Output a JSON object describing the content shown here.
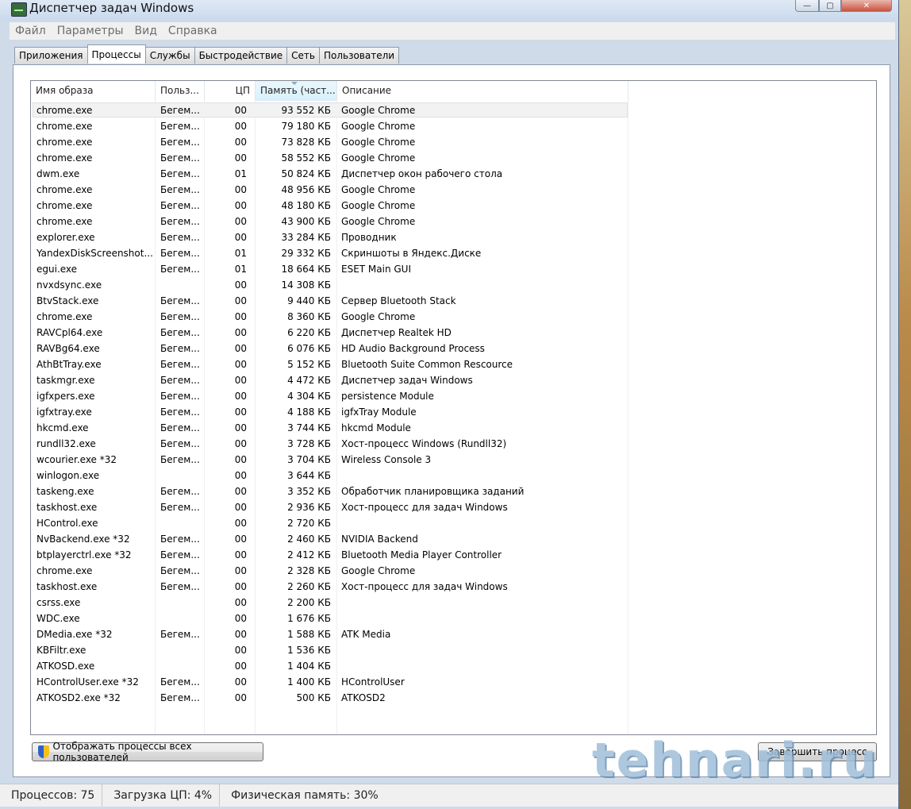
{
  "window": {
    "title": "Диспетчер задач Windows"
  },
  "menu": [
    "Файл",
    "Параметры",
    "Вид",
    "Справка"
  ],
  "tabs": [
    {
      "label": "Приложения",
      "active": false
    },
    {
      "label": "Процессы",
      "active": true
    },
    {
      "label": "Службы",
      "active": false
    },
    {
      "label": "Быстродействие",
      "active": false
    },
    {
      "label": "Сеть",
      "active": false
    },
    {
      "label": "Пользователи",
      "active": false
    }
  ],
  "columns": {
    "name": "Имя образа",
    "user": "Польз...",
    "cpu": "ЦП",
    "memory": "Память (част...",
    "description": "Описание"
  },
  "processes": [
    {
      "name": "chrome.exe",
      "user": "Бегем...",
      "cpu": "00",
      "mem": "93 552 КБ",
      "desc": "Google Chrome"
    },
    {
      "name": "chrome.exe",
      "user": "Бегем...",
      "cpu": "00",
      "mem": "79 180 КБ",
      "desc": "Google Chrome"
    },
    {
      "name": "chrome.exe",
      "user": "Бегем...",
      "cpu": "00",
      "mem": "73 828 КБ",
      "desc": "Google Chrome"
    },
    {
      "name": "chrome.exe",
      "user": "Бегем...",
      "cpu": "00",
      "mem": "58 552 КБ",
      "desc": "Google Chrome"
    },
    {
      "name": "dwm.exe",
      "user": "Бегем...",
      "cpu": "01",
      "mem": "50 824 КБ",
      "desc": "Диспетчер окон рабочего стола"
    },
    {
      "name": "chrome.exe",
      "user": "Бегем...",
      "cpu": "00",
      "mem": "48 956 КБ",
      "desc": "Google Chrome"
    },
    {
      "name": "chrome.exe",
      "user": "Бегем...",
      "cpu": "00",
      "mem": "48 180 КБ",
      "desc": "Google Chrome"
    },
    {
      "name": "chrome.exe",
      "user": "Бегем...",
      "cpu": "00",
      "mem": "43 900 КБ",
      "desc": "Google Chrome"
    },
    {
      "name": "explorer.exe",
      "user": "Бегем...",
      "cpu": "00",
      "mem": "33 284 КБ",
      "desc": "Проводник"
    },
    {
      "name": "YandexDiskScreenshot...",
      "user": "Бегем...",
      "cpu": "01",
      "mem": "29 332 КБ",
      "desc": "Скриншоты в Яндекс.Диске"
    },
    {
      "name": "egui.exe",
      "user": "Бегем...",
      "cpu": "01",
      "mem": "18 664 КБ",
      "desc": "ESET Main GUI"
    },
    {
      "name": "nvxdsync.exe",
      "user": "",
      "cpu": "00",
      "mem": "14 308 КБ",
      "desc": ""
    },
    {
      "name": "BtvStack.exe",
      "user": "Бегем...",
      "cpu": "00",
      "mem": "9 440 КБ",
      "desc": "Сервер Bluetooth Stack"
    },
    {
      "name": "chrome.exe",
      "user": "Бегем...",
      "cpu": "00",
      "mem": "8 360 КБ",
      "desc": "Google Chrome"
    },
    {
      "name": "RAVCpl64.exe",
      "user": "Бегем...",
      "cpu": "00",
      "mem": "6 220 КБ",
      "desc": "Диспетчер Realtek HD"
    },
    {
      "name": "RAVBg64.exe",
      "user": "Бегем...",
      "cpu": "00",
      "mem": "6 076 КБ",
      "desc": "HD Audio Background Process"
    },
    {
      "name": "AthBtTray.exe",
      "user": "Бегем...",
      "cpu": "00",
      "mem": "5 152 КБ",
      "desc": "Bluetooth Suite Common Rescource"
    },
    {
      "name": "taskmgr.exe",
      "user": "Бегем...",
      "cpu": "00",
      "mem": "4 472 КБ",
      "desc": "Диспетчер задач Windows"
    },
    {
      "name": "igfxpers.exe",
      "user": "Бегем...",
      "cpu": "00",
      "mem": "4 304 КБ",
      "desc": "persistence Module"
    },
    {
      "name": "igfxtray.exe",
      "user": "Бегем...",
      "cpu": "00",
      "mem": "4 188 КБ",
      "desc": "igfxTray Module"
    },
    {
      "name": "hkcmd.exe",
      "user": "Бегем...",
      "cpu": "00",
      "mem": "3 744 КБ",
      "desc": "hkcmd Module"
    },
    {
      "name": "rundll32.exe",
      "user": "Бегем...",
      "cpu": "00",
      "mem": "3 728 КБ",
      "desc": "Хост-процесс Windows (Rundll32)"
    },
    {
      "name": "wcourier.exe *32",
      "user": "Бегем...",
      "cpu": "00",
      "mem": "3 704 КБ",
      "desc": "Wireless Console 3"
    },
    {
      "name": "winlogon.exe",
      "user": "",
      "cpu": "00",
      "mem": "3 644 КБ",
      "desc": ""
    },
    {
      "name": "taskeng.exe",
      "user": "Бегем...",
      "cpu": "00",
      "mem": "3 352 КБ",
      "desc": "Обработчик планировщика заданий"
    },
    {
      "name": "taskhost.exe",
      "user": "Бегем...",
      "cpu": "00",
      "mem": "2 936 КБ",
      "desc": "Хост-процесс для задач Windows"
    },
    {
      "name": "HControl.exe",
      "user": "",
      "cpu": "00",
      "mem": "2 720 КБ",
      "desc": ""
    },
    {
      "name": "NvBackend.exe *32",
      "user": "Бегем...",
      "cpu": "00",
      "mem": "2 460 КБ",
      "desc": "NVIDIA Backend"
    },
    {
      "name": "btplayerctrl.exe *32",
      "user": "Бегем...",
      "cpu": "00",
      "mem": "2 412 КБ",
      "desc": "Bluetooth Media Player Controller"
    },
    {
      "name": "chrome.exe",
      "user": "Бегем...",
      "cpu": "00",
      "mem": "2 328 КБ",
      "desc": "Google Chrome"
    },
    {
      "name": "taskhost.exe",
      "user": "Бегем...",
      "cpu": "00",
      "mem": "2 260 КБ",
      "desc": "Хост-процесс для задач Windows"
    },
    {
      "name": "csrss.exe",
      "user": "",
      "cpu": "00",
      "mem": "2 200 КБ",
      "desc": ""
    },
    {
      "name": "WDC.exe",
      "user": "",
      "cpu": "00",
      "mem": "1 676 КБ",
      "desc": ""
    },
    {
      "name": "DMedia.exe *32",
      "user": "Бегем...",
      "cpu": "00",
      "mem": "1 588 КБ",
      "desc": "ATK Media"
    },
    {
      "name": "KBFiltr.exe",
      "user": "",
      "cpu": "00",
      "mem": "1 536 КБ",
      "desc": ""
    },
    {
      "name": "ATKOSD.exe",
      "user": "",
      "cpu": "00",
      "mem": "1 404 КБ",
      "desc": ""
    },
    {
      "name": "HControlUser.exe *32",
      "user": "Бегем...",
      "cpu": "00",
      "mem": "1 400 КБ",
      "desc": "HControlUser"
    },
    {
      "name": "ATKOSD2.exe *32",
      "user": "Бегем...",
      "cpu": "00",
      "mem": "500 КБ",
      "desc": "ATKOSD2"
    }
  ],
  "buttons": {
    "show_all": "Отображать процессы всех пользователей",
    "end_process": "Завершить процесс"
  },
  "watermark": "tehnari.ru",
  "status": {
    "processes": "Процессов: 75",
    "cpu": "Загрузка ЦП: 4%",
    "memory": "Физическая память: 30%"
  },
  "icons": {
    "app": "task-manager-icon",
    "shield": "uac-shield-icon"
  }
}
